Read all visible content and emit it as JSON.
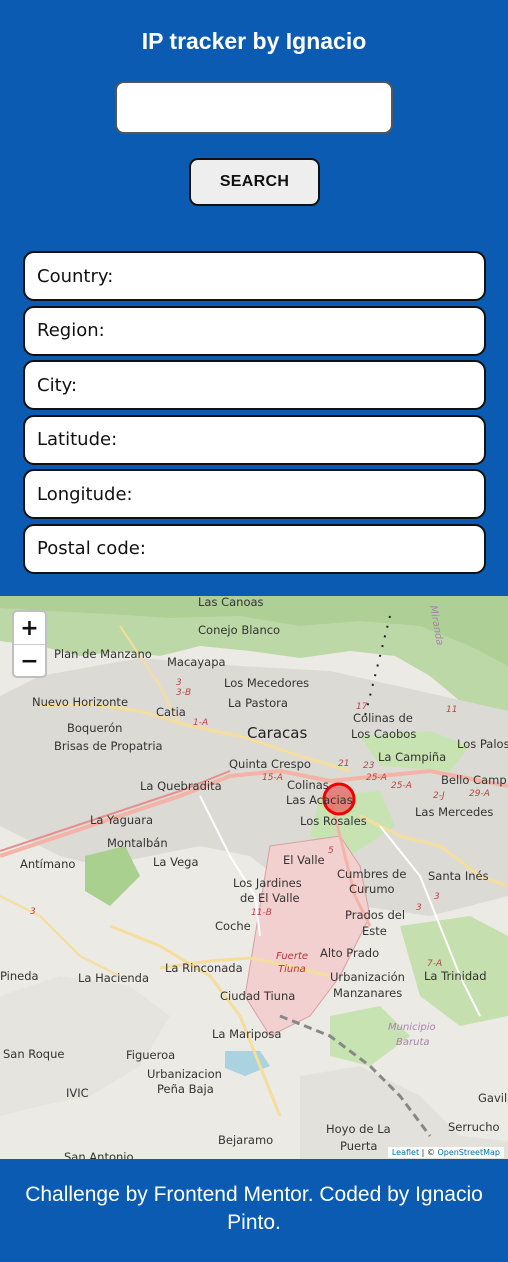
{
  "header": {
    "title": "IP tracker by Ignacio",
    "search_input_value": "",
    "search_button_label": "SEARCH"
  },
  "info": {
    "country_label": "Country:",
    "region_label": "Region:",
    "city_label": "City:",
    "latitude_label": "Latitude:",
    "longitude_label": "Longitude:",
    "postal_code_label": "Postal code:"
  },
  "map": {
    "zoom_in": "+",
    "zoom_out": "−",
    "attribution_leaflet": "Leaflet",
    "attribution_sep": " | © ",
    "attribution_osm": "OpenStreetMap",
    "places": {
      "las_canoas": "Las Canoas",
      "conejo_blanco": "Conejo Blanco",
      "miranda": "Miranda",
      "plan_de_manzano": "Plan de Manzano",
      "macayapa": "Macayapa",
      "los_mecedores": "Los Mecedores",
      "nuevo_horizonte": "Nuevo Horizonte",
      "catia": "Catia",
      "la_pastora": "La Pastora",
      "colinas_de": "Colinas de",
      "los_caobos": "Los Caobos",
      "boqueron": "Boquerón",
      "brisas": "Brisas de Propatria",
      "caracas": "Caracas",
      "los_palos": "Los Palos",
      "la_campina": "La Campiña",
      "quinta_crespo": "Quinta Crespo",
      "la_quebradita": "La Quebradita",
      "colinas": "Colinas",
      "las_acacias": "Las Acacias",
      "bello_camp": "Bello Camp",
      "la_yaguara": "La Yaguara",
      "los_rosales": "Los Rosales",
      "las_mercedes": "Las Mercedes",
      "montalban": "Montalbán",
      "antimano": "Antímano",
      "la_vega": "La Vega",
      "el_valle": "El Valle",
      "cumbres": "Cumbres de",
      "curumo": "Curumo",
      "santa_ines": "Santa Inés",
      "los_jardines": "Los Jardines",
      "del_valle": "de El Valle",
      "prados": "Prados del",
      "este": "Este",
      "coche": "Coche",
      "fuerte": "Fuerte",
      "tiuna": "Tiuna",
      "alto_prado": "Alto Prado",
      "pineda": "Pineda",
      "la_hacienda": "La Hacienda",
      "la_rinconada": "La Rinconada",
      "urbanizacion": "Urbanización",
      "manzanares": "Manzanares",
      "la_trinidad": "La Trinidad",
      "ciudad_tiuna": "Ciudad Tiuna",
      "municipio": "Municipio",
      "baruta": "Baruta",
      "la_mariposa": "La Mariposa",
      "san_roque": "San Roque",
      "figueroa": "Figueroa",
      "urb_pena": "Urbanizacion",
      "pena_baja": "Peña Baja",
      "ivic": "IVIC",
      "gavila": "Gavila",
      "serrucho": "Serrucho",
      "bejaramo": "Bejaramo",
      "hoyo": "Hoyo de La",
      "puerta": "Puerta",
      "san_antonio": "San Antonio"
    },
    "road_numbers": {
      "r3a": "3",
      "r3b": "3-B",
      "r1a": "1-A",
      "r15a": "15-A",
      "r21": "21",
      "r23": "23",
      "r25a1": "25-A",
      "r25a2": "25-A",
      "r2j": "2-J",
      "r29a": "29-A",
      "r5": "5",
      "r11b": "11-B",
      "r7a": "7-A",
      "r17": "17",
      "r11": "11",
      "r3c": "3",
      "r3d": "3",
      "r3e": "3"
    }
  },
  "footer": {
    "text": "Challenge by Frontend Mentor. Coded by Ignacio Pinto."
  }
}
